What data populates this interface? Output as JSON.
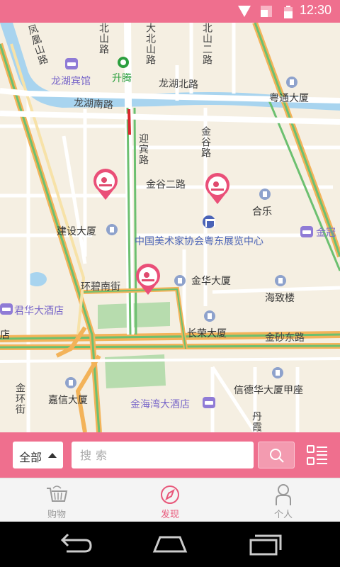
{
  "status_bar": {
    "time": "12:30",
    "icons": [
      "wifi-icon",
      "signal-icon",
      "battery-icon"
    ]
  },
  "map": {
    "roads": {
      "fenghuangshan": "凤凰山路",
      "yingbin_north": "北山路",
      "dabei_north": "大北山路",
      "bei_shan_2": "北山二路",
      "longhu_north": "龙湖北路",
      "longhu_south": "龙湖南路",
      "yingbin": "迎宾路",
      "jingu": "金谷路",
      "jingu_2": "金谷二路",
      "huanbi_south": "环碧南街",
      "jinsha_east": "金砂东路",
      "jinhuan": "金环街",
      "danxia": "丹霞"
    },
    "places": {
      "longhu_hotel": "龙湖宾馆",
      "shengteng": "升腾",
      "yuetong": "粤通大厦",
      "hele": "合乐",
      "jianshe": "建设大厦",
      "art_center": "中国美术家协会粤东展览中心",
      "jinguan": "金冠",
      "jinhua": "金华大厦",
      "haizhi": "海致楼",
      "junhua": "君华大酒店",
      "changrong": "长荣大厦",
      "jiaxin": "嘉信大厦",
      "jinhaiwan": "金海湾大酒店",
      "xindehua": "信德华大厦甲座",
      "partial_left": "店"
    },
    "pins": [
      "store-pin",
      "store-pin",
      "store-pin"
    ]
  },
  "search": {
    "category": "全部",
    "placeholder": "搜索"
  },
  "tabs": [
    {
      "label": "购物",
      "icon": "basket-icon",
      "active": false
    },
    {
      "label": "发现",
      "icon": "compass-icon",
      "active": true
    },
    {
      "label": "个人",
      "icon": "person-icon",
      "active": false
    }
  ],
  "colors": {
    "brand": "#ef6f8e",
    "active_tab": "#e8577a",
    "map_bg": "#f5efe2",
    "water": "#a8d4ef"
  }
}
